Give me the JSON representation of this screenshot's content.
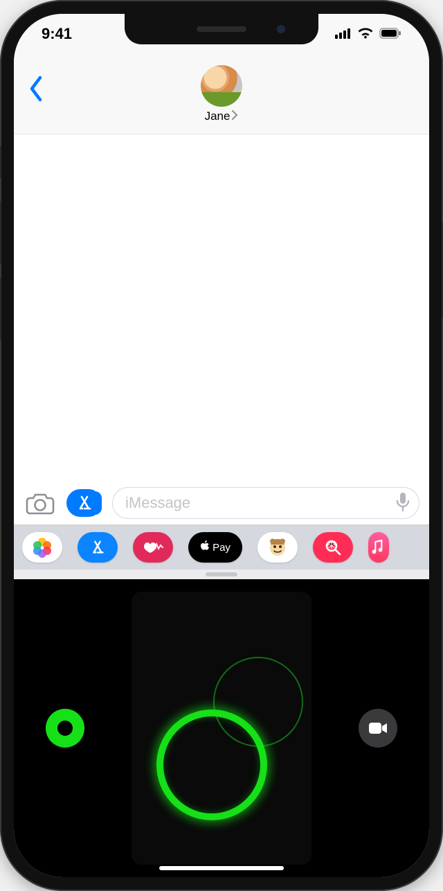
{
  "status": {
    "time": "9:41"
  },
  "header": {
    "contact_name": "Jane"
  },
  "compose": {
    "placeholder": "iMessage"
  },
  "app_drawer": {
    "apple_pay_label": "Pay"
  },
  "icons": {
    "back": "chevron-left-icon",
    "camera": "camera-icon",
    "appstore": "appstore-icon",
    "mic": "microphone-icon",
    "photos": "photos-app-icon",
    "heart": "heartbeat-icon",
    "applelogo": "apple-logo-icon",
    "memoji": "memoji-icon",
    "searchglobe": "images-search-icon",
    "music": "music-icon",
    "colorpicker": "color-picker-button",
    "videorecord": "video-record-button",
    "signal": "cellular-signal-icon",
    "wifi": "wifi-icon",
    "battery": "battery-icon"
  }
}
